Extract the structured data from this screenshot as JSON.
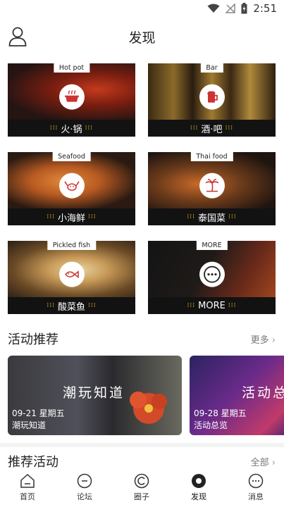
{
  "status": {
    "time": "2:51"
  },
  "header": {
    "title": "发现"
  },
  "categories": [
    {
      "tag": "Hot pot",
      "label": "火·锅",
      "icon": "hotpot-icon"
    },
    {
      "tag": "Bar",
      "label": "酒·吧",
      "icon": "beer-icon"
    },
    {
      "tag": "Seafood",
      "label": "小海鲜",
      "icon": "crab-icon"
    },
    {
      "tag": "Thai food",
      "label": "泰国菜",
      "icon": "palm-tree-icon"
    },
    {
      "tag": "Pickled fish",
      "label": "酸菜鱼",
      "icon": "fish-icon"
    },
    {
      "tag": "MORE",
      "label": "MORE",
      "icon": "more-icon"
    }
  ],
  "activity_recommend": {
    "title": "活动推荐",
    "more": "更多",
    "events": [
      {
        "big_text": "潮玩知道",
        "date": "09-21 星期五",
        "name": "潮玩知道"
      },
      {
        "big_text": "活动总",
        "date": "09-28 星期五",
        "name": "活动总览"
      }
    ]
  },
  "recommended": {
    "title": "推荐活动",
    "more": "全部"
  },
  "tabs": [
    {
      "label": "首页",
      "icon": "home-icon"
    },
    {
      "label": "论坛",
      "icon": "forum-icon"
    },
    {
      "label": "圈子",
      "icon": "circle-icon"
    },
    {
      "label": "发现",
      "icon": "discover-icon",
      "active": true
    },
    {
      "label": "消息",
      "icon": "message-icon"
    }
  ]
}
